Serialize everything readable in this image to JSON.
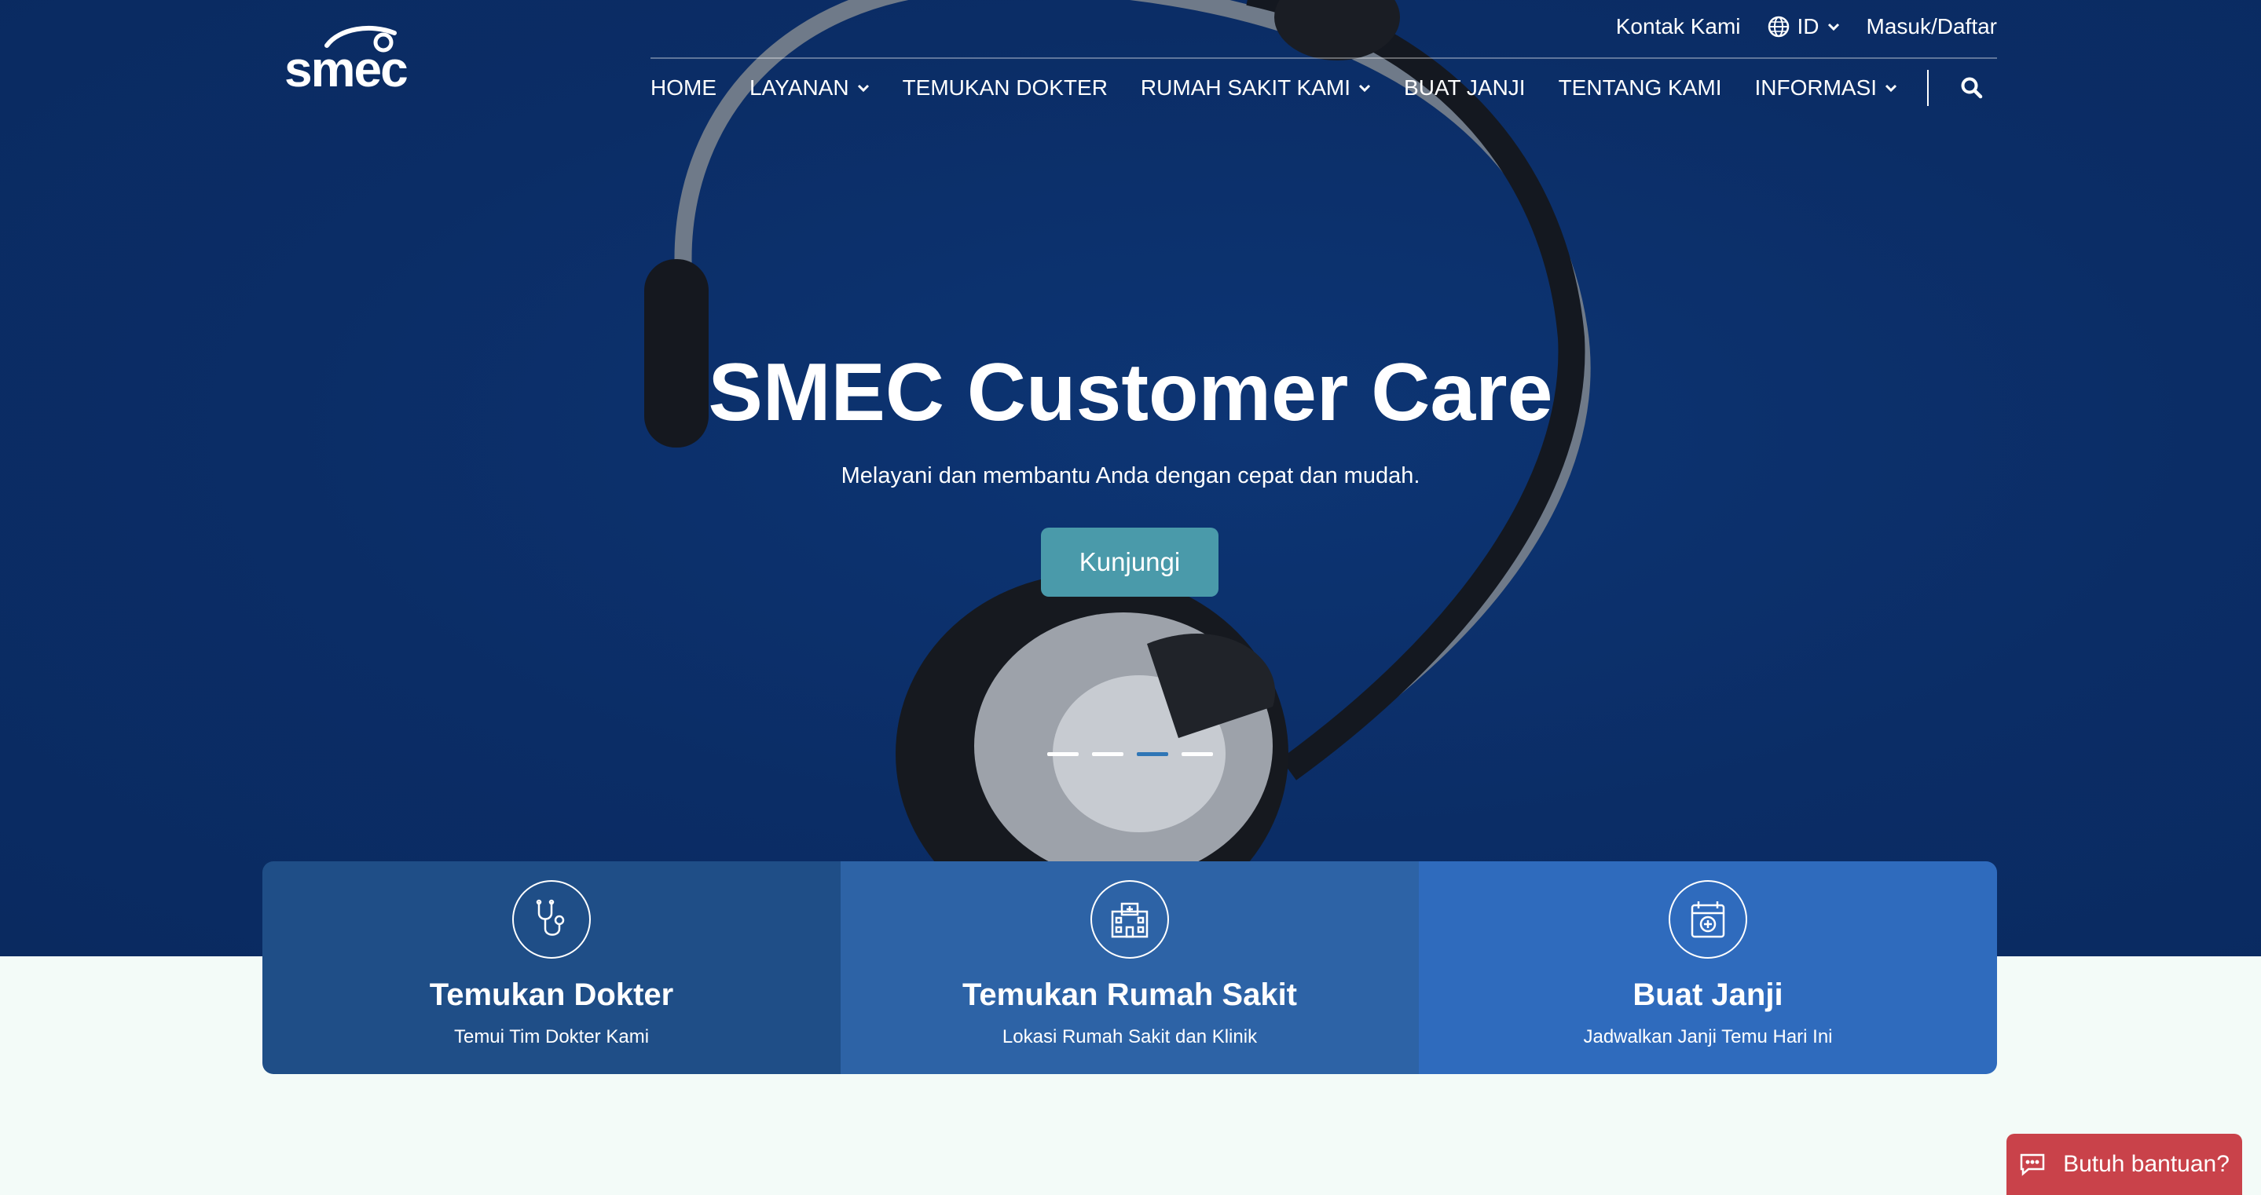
{
  "logo": {
    "text": "smec"
  },
  "topbar": {
    "contact": "Kontak Kami",
    "language": "ID",
    "login": "Masuk/Daftar"
  },
  "nav": {
    "items": [
      {
        "label": "HOME",
        "dropdown": false
      },
      {
        "label": "LAYANAN",
        "dropdown": true
      },
      {
        "label": "TEMUKAN DOKTER",
        "dropdown": false
      },
      {
        "label": "RUMAH SAKIT KAMI",
        "dropdown": true
      },
      {
        "label": "BUAT JANJI",
        "dropdown": false
      },
      {
        "label": "TENTANG KAMI",
        "dropdown": false
      },
      {
        "label": "INFORMASI",
        "dropdown": true
      }
    ]
  },
  "hero": {
    "title": "SMEC Customer Care",
    "subtitle": "Melayani dan membantu Anda dengan cepat dan mudah.",
    "cta": "Kunjungi",
    "slides": 4,
    "active_slide": 3
  },
  "cards": [
    {
      "icon": "stethoscope-icon",
      "title": "Temukan Dokter",
      "subtitle": "Temui Tim Dokter Kami"
    },
    {
      "icon": "hospital-icon",
      "title": "Temukan Rumah Sakit",
      "subtitle": "Lokasi Rumah Sakit dan Klinik"
    },
    {
      "icon": "calendar-icon",
      "title": "Buat Janji",
      "subtitle": "Jadwalkan Janji Temu Hari Ini"
    }
  ],
  "help": {
    "label": "Butuh bantuan?",
    "icon": "chat-icon"
  },
  "colors": {
    "hero_bg": "#0b2d66",
    "cta": "#4a9aaa",
    "card_1": "#1f4e87",
    "card_2": "#2d63a6",
    "card_3": "#2f6bbd",
    "help": "#c9424a",
    "page_bg": "#f3fbf8"
  }
}
